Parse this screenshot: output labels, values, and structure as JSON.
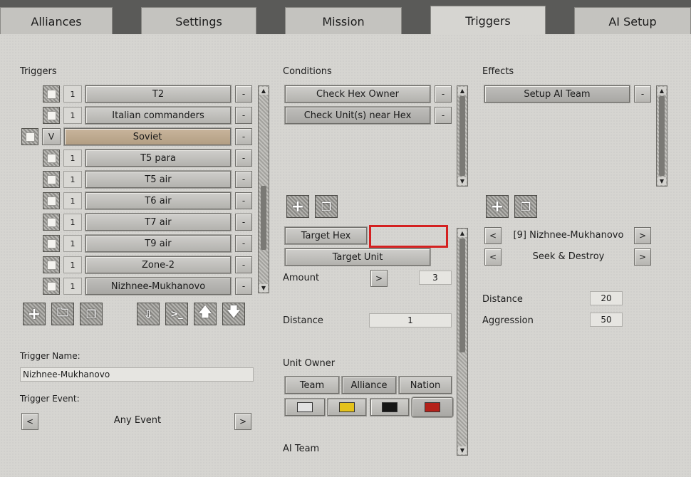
{
  "tabs": [
    "Alliances",
    "Settings",
    "Mission",
    "Triggers",
    "AI Setup"
  ],
  "triggers": {
    "label": "Triggers",
    "rows": [
      {
        "num": "1",
        "name": "T2"
      },
      {
        "num": "1",
        "name": "Italian commanders"
      },
      {
        "num": "V",
        "name": "Soviet"
      },
      {
        "num": "1",
        "name": "T5 para"
      },
      {
        "num": "1",
        "name": "T5 air"
      },
      {
        "num": "1",
        "name": "T6 air"
      },
      {
        "num": "1",
        "name": "T7 air"
      },
      {
        "num": "1",
        "name": "T9 air"
      },
      {
        "num": "1",
        "name": "Zone-2"
      },
      {
        "num": "1",
        "name": "Nizhnee-Mukhanovo"
      }
    ],
    "remove": "-",
    "name_label": "Trigger Name:",
    "name_value": "Nizhnee-Mukhanovo",
    "event_label": "Trigger Event:",
    "event_value": "Any Event",
    "prev": "<",
    "next": ">"
  },
  "conditions": {
    "label": "Conditions",
    "items": [
      "Check Hex Owner",
      "Check Unit(s) near Hex"
    ],
    "remove": "-",
    "target_hex": "Target Hex",
    "target_unit": "Target Unit",
    "amount_label": "Amount",
    "amount_btn": ">",
    "amount_value": "3",
    "distance_label": "Distance",
    "distance_value": "1",
    "unit_owner_label": "Unit Owner",
    "owner_tabs": [
      "Team",
      "Alliance",
      "Nation"
    ],
    "ai_team_label": "AI Team",
    "colors": [
      "#e2e2e2",
      "#e4c21c",
      "#161616",
      "#b4211a"
    ]
  },
  "effects": {
    "label": "Effects",
    "items": [
      "Setup AI Team"
    ],
    "remove": "-",
    "target_value": "[9] Nizhnee-Mukhanovo",
    "mode_value": "Seek & Destroy",
    "prev": "<",
    "next": ">",
    "distance_label": "Distance",
    "distance_value": "20",
    "aggression_label": "Aggression",
    "aggression_value": "50"
  },
  "colors": {
    "highlight_border": "#d42020",
    "selected_row": "#b8a48a"
  }
}
